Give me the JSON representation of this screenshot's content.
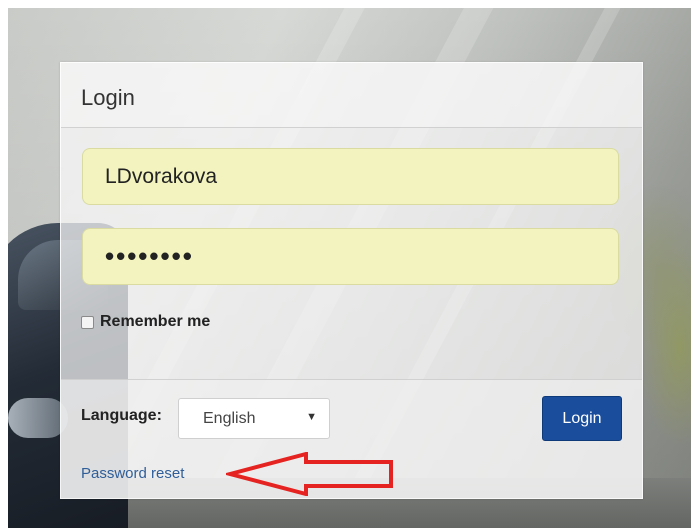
{
  "login": {
    "title": "Login",
    "username_value": "LDvorakova",
    "password_masked": "••••••••",
    "remember_label": "Remember me",
    "language_label": "Language:",
    "language_selected": "English",
    "submit_label": "Login",
    "reset_link": "Password reset"
  },
  "colors": {
    "input_autofill_bg": "#f2f3bf",
    "button_bg": "#1a4e9c",
    "link": "#2f5e99",
    "annotation_arrow": "#e52421"
  }
}
